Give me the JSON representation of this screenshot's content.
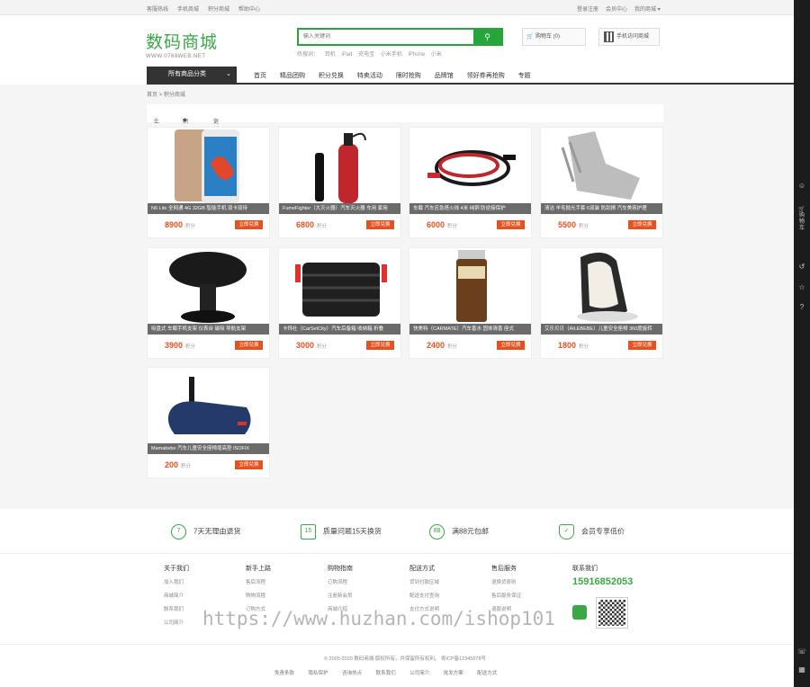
{
  "topbar": {
    "left_links": [
      "客服热线",
      "手机商城",
      "积分商城",
      "帮助中心"
    ],
    "right_links": [
      "登录注册",
      "会员中心",
      "我的商城"
    ],
    "right_arrow": "▾"
  },
  "logo": {
    "cn": "数码商城",
    "en": "WWW.0768WEB.NET"
  },
  "search": {
    "placeholder": "输入关键词",
    "hot_label": "热搜词：",
    "hot": [
      "耳机",
      "iPad",
      "充电宝",
      "小米手机",
      "iPhone",
      "小米"
    ]
  },
  "cart": {
    "label": "购物车 (0)"
  },
  "qr": {
    "label": "手机访问商城"
  },
  "nav": {
    "category_label": "所有商品分类",
    "category_arrow": "⌄",
    "items": [
      "首页",
      "精品团购",
      "积分兑换",
      "特卖活动",
      "限时抢购",
      "品牌馆",
      "领好券再抢购",
      "专题"
    ]
  },
  "breadcrumb": "首页 > 积分商城",
  "sort": [
    {
      "label": "上架",
      "mark": "◆"
    },
    {
      "label": "积分",
      "mark": "◆"
    },
    {
      "label": "更新",
      "mark": "◆"
    }
  ],
  "products": [
    {
      "name": "N6 Lite 全网通 4G 32GB 智能手机 双卡双待",
      "price": "8900",
      "unit": "积分",
      "button": "立即兑换",
      "icon": "phone-image"
    },
    {
      "name": "FumeFighter（大灭火器）汽车灭火器 车用 家用",
      "price": "6800",
      "unit": "积分",
      "button": "立即兑换",
      "icon": "extinguisher-image"
    },
    {
      "name": "车载 汽车应急搭火线 4米 纯铜 防逆接保护",
      "price": "6000",
      "unit": "积分",
      "button": "立即兑换",
      "icon": "cable-image"
    },
    {
      "name": "清洁 羊毛抛光手套 6双装 防刮擦 汽车美容护理",
      "price": "5500",
      "unit": "积分",
      "button": "立即兑换",
      "icon": "glove-image"
    },
    {
      "name": "吸盘式 车载手机支架 仪表台 磁吸 导航支架",
      "price": "3900",
      "unit": "积分",
      "button": "立即兑换",
      "icon": "holder-image"
    },
    {
      "name": "卡饰社（CarSetCity）汽车后备箱 收纳箱 折叠",
      "price": "3000",
      "unit": "积分",
      "button": "立即兑换",
      "icon": "storage-box-image"
    },
    {
      "name": "快美特（CARMATE）汽车香水 固体清香 座式",
      "price": "2400",
      "unit": "积分",
      "button": "立即兑换",
      "icon": "perfume-image"
    },
    {
      "name": "艾乐贝贝（AILEBEBE）儿童安全座椅 360度旋转",
      "price": "1800",
      "unit": "积分",
      "button": "立即兑换",
      "icon": "seat-image"
    },
    {
      "name": "Mamabebe 汽车儿童安全座椅增高垫 ISOFIX",
      "price": "200",
      "unit": "积分",
      "button": "立即兑换",
      "icon": "booster-image"
    }
  ],
  "features": [
    {
      "icon": "7",
      "label": "7天无理由退货"
    },
    {
      "icon": "15",
      "label": "质量问题15天换货"
    },
    {
      "icon": "88",
      "label": "满88元包邮"
    },
    {
      "icon": "✓",
      "label": "会员专享低价"
    }
  ],
  "footer_cols": [
    {
      "title": "关于我们",
      "links": [
        "加入我们",
        "商城简介",
        "联系我们",
        "公司简介"
      ]
    },
    {
      "title": "新手上路",
      "links": [
        "售后流程",
        "购物流程",
        "订购方式"
      ]
    },
    {
      "title": "购物指南",
      "links": [
        "订购流程",
        "注册新会员",
        "商城介绍"
      ]
    },
    {
      "title": "配送方式",
      "links": [
        "货到付款区域",
        "配送支付查询",
        "支付方式说明"
      ]
    },
    {
      "title": "售后服务",
      "links": [
        "退换货原则",
        "售后服务保证",
        "退款说明"
      ]
    }
  ],
  "contact": {
    "title": "联系我们",
    "phone": "15916852053"
  },
  "watermark": "https://www.huzhan.com/ishop101",
  "copyright": "© 2005-2020 数码商城 版权所有，并保留所有权利。   粤ICP备12345678号",
  "footer_links": [
    "免责条款",
    "隐私保护",
    "咨询热点",
    "联系我们",
    "公司简介",
    "批发方案",
    "配送方式"
  ],
  "sidebar_icons": [
    "user-icon",
    "cart-icon",
    "history-icon",
    "star-icon",
    "help-icon",
    "headset-icon",
    "qr-icon"
  ],
  "sidebar_cart_text": "购物车",
  "colors": {
    "green": "#25a53a",
    "orange": "#e8511d",
    "dark": "#333333"
  }
}
